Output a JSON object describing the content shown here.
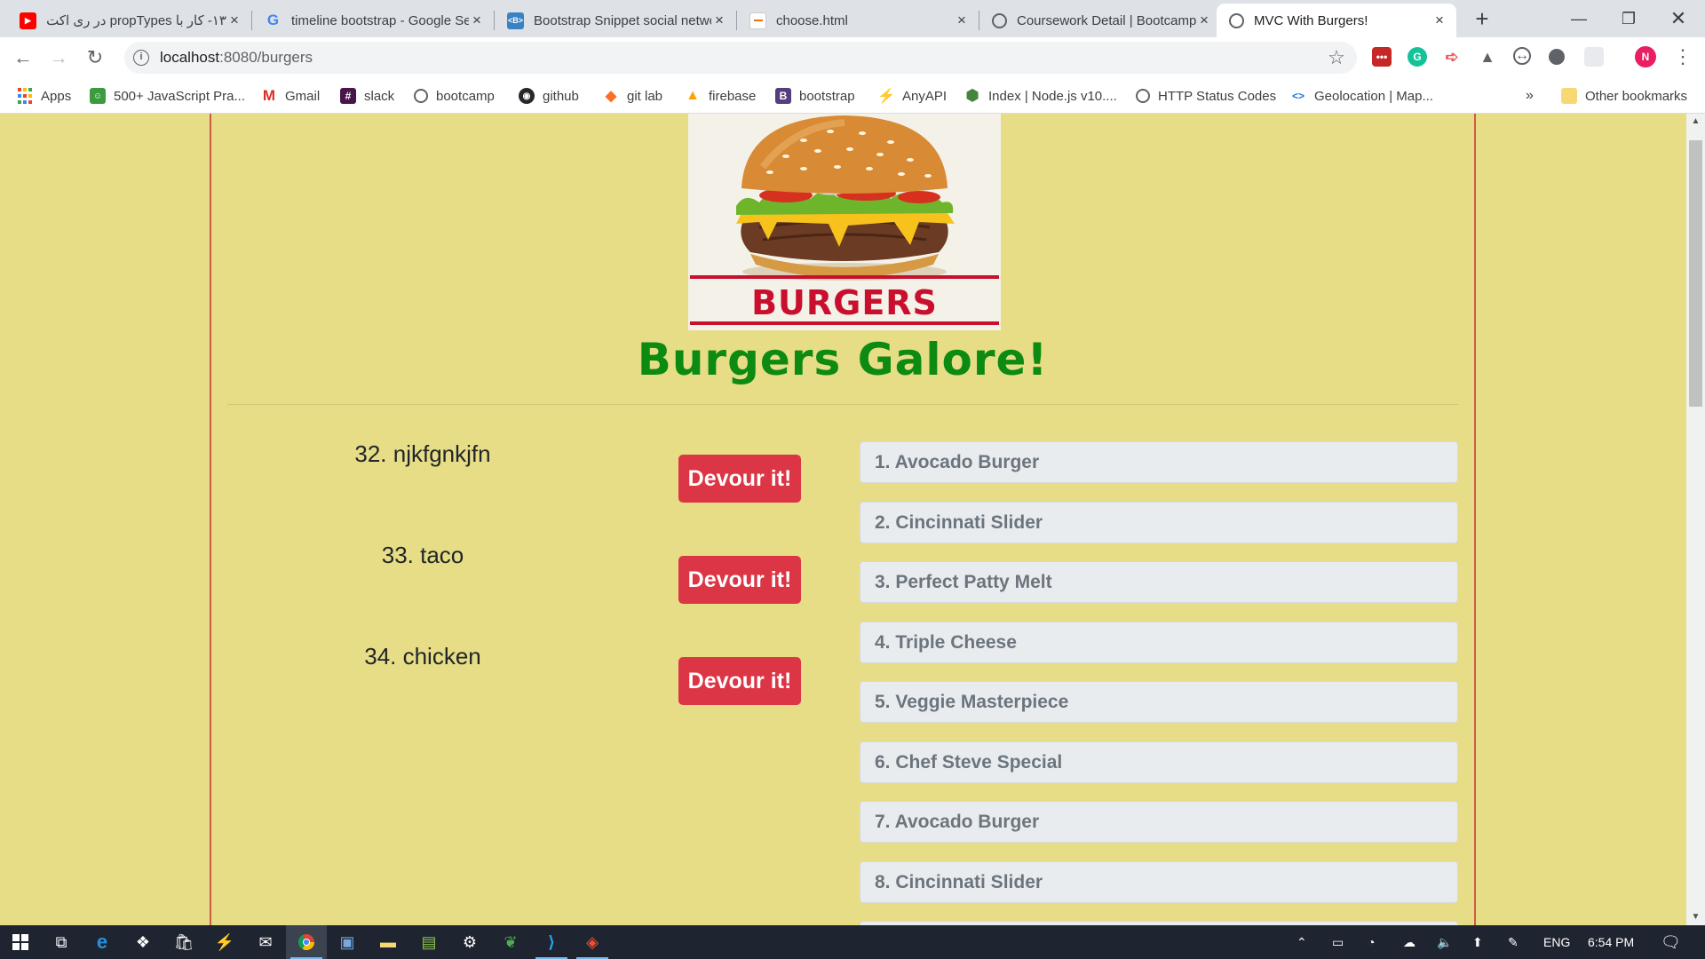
{
  "browser": {
    "tabs": [
      {
        "title": "‫۱۳- کار با propTypes در ری اکت‬",
        "icon": "youtube-icon",
        "active": false
      },
      {
        "title": "timeline bootstrap - Google Search",
        "icon": "google-icon",
        "active": false
      },
      {
        "title": "Bootstrap Snippet social network",
        "icon": "bootsnipp-icon",
        "active": false
      },
      {
        "title": "choose.html",
        "icon": "file-icon",
        "active": false
      },
      {
        "title": "Coursework Detail | Bootcamp",
        "icon": "globe-icon",
        "active": false
      },
      {
        "title": "MVC With Burgers!",
        "icon": "globe-icon",
        "active": true
      }
    ],
    "new_tab": "+",
    "url_host": "localhost",
    "url_path": ":8080/burgers",
    "bookmarks": [
      {
        "label": "Apps",
        "icon": "apps-grid-icon"
      },
      {
        "label": "500+ JavaScript Pra...",
        "icon": "js-practice-icon"
      },
      {
        "label": "Gmail",
        "icon": "gmail-icon"
      },
      {
        "label": "slack",
        "icon": "slack-icon"
      },
      {
        "label": "bootcamp",
        "icon": "globe-icon"
      },
      {
        "label": "github",
        "icon": "github-icon"
      },
      {
        "label": "git lab",
        "icon": "gitlab-icon"
      },
      {
        "label": "firebase",
        "icon": "firebase-icon"
      },
      {
        "label": "bootstrap",
        "icon": "bootstrap-icon"
      },
      {
        "label": "AnyAPI",
        "icon": "anyapi-icon"
      },
      {
        "label": "Index | Node.js v10....",
        "icon": "nodejs-icon"
      },
      {
        "label": "HTTP Status Codes",
        "icon": "globe-icon"
      },
      {
        "label": "Geolocation  |  Map...",
        "icon": "code-icon"
      }
    ],
    "bookmarks_overflow": "»",
    "other_bookmarks": "Other bookmarks",
    "profile_initial": "N"
  },
  "page": {
    "logo_text": "BURGERS",
    "heading": "Burgers Galore!",
    "devour_label": "Devour it!",
    "uneaten": [
      {
        "name": "32. njkfgnkjfn"
      },
      {
        "name": "33. taco"
      },
      {
        "name": "34. chicken"
      }
    ],
    "eaten": [
      {
        "name": "1. Avocado Burger"
      },
      {
        "name": "2. Cincinnati Slider"
      },
      {
        "name": "3. Perfect Patty Melt"
      },
      {
        "name": "4. Triple Cheese"
      },
      {
        "name": "5. Veggie Masterpiece"
      },
      {
        "name": "6. Chef Steve Special"
      },
      {
        "name": "7. Avocado Burger"
      },
      {
        "name": "8. Cincinnati Slider"
      }
    ]
  },
  "taskbar": {
    "language": "ENG",
    "time": "6:54 PM"
  },
  "colors": {
    "page_bg": "#e6dd86",
    "heading": "#0d8a12",
    "devour_button": "#dc3545",
    "eaten_item_bg": "#e9ecef",
    "container_border": "#cc5b48"
  }
}
